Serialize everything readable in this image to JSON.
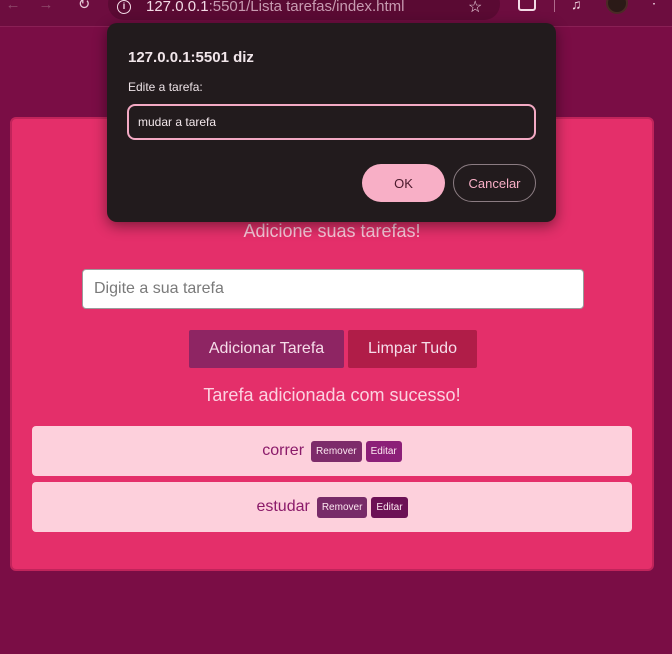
{
  "browser": {
    "back_icon": "←",
    "forward_icon": "→",
    "reload_icon": "↻",
    "url_host": "127.0.0.1",
    "url_rest": ":5501/Lista tarefas/index.html",
    "star_icon": "☆",
    "media_icon": "♫",
    "menu_icon": "⋮"
  },
  "app": {
    "subtitle": "Adicione suas tarefas!",
    "input_placeholder": "Digite a sua tarefa",
    "add_button": "Adicionar Tarefa",
    "clear_button": "Limpar Tudo",
    "status": "Tarefa adicionada com sucesso!",
    "tasks": [
      {
        "name": "correr",
        "remove_label": "Remover",
        "edit_label": "Editar"
      },
      {
        "name": "estudar",
        "remove_label": "Remover",
        "edit_label": "Editar"
      }
    ]
  },
  "dialog": {
    "title": "127.0.0.1:5501 diz",
    "message": "Edite a tarefa:",
    "input_value": "mudar a tarefa",
    "ok_label": "OK",
    "cancel_label": "Cancelar"
  },
  "colors": {
    "page_bg": "#7a0d45",
    "card_bg": "#e42f6a",
    "task_bg": "#fdd0dc",
    "dialog_bg": "#221b1d",
    "accent_pink": "#f8afc6"
  }
}
